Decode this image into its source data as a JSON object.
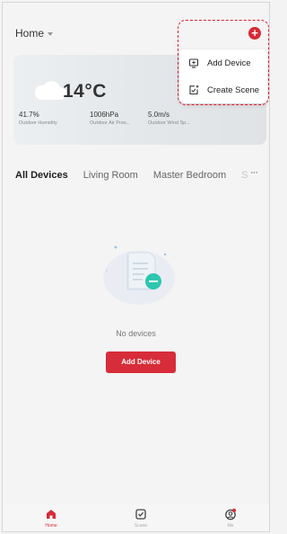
{
  "header": {
    "home_label": "Home",
    "add_symbol": "+"
  },
  "weather": {
    "temperature": "14°C",
    "humidity_value": "41.7%",
    "humidity_label": "Outdoor Humidity",
    "pressure_value": "1006hPa",
    "pressure_label": "Outdoor Air Pres...",
    "wind_value": "5.0m/s",
    "wind_label": "Outdoor Wind Sp..."
  },
  "tabs": [
    {
      "label": "All Devices",
      "active": true
    },
    {
      "label": "Living Room",
      "active": false
    },
    {
      "label": "Master Bedroom",
      "active": false
    },
    {
      "label": "S",
      "active": false
    }
  ],
  "tabs_more": "···",
  "empty_state": {
    "message": "No devices",
    "cta_label": "Add Device"
  },
  "dropdown": {
    "items": [
      {
        "label": "Add Device",
        "icon": "add-device-icon"
      },
      {
        "label": "Create Scene",
        "icon": "create-scene-icon"
      }
    ]
  },
  "bottom_nav": {
    "items": [
      {
        "label": "Home",
        "icon": "home-icon",
        "active": true
      },
      {
        "label": "Scene",
        "icon": "scene-icon",
        "active": false
      },
      {
        "label": "Me",
        "icon": "me-icon",
        "active": false
      }
    ]
  },
  "colors": {
    "accent": "#d62b38",
    "annotation": "#e0202c",
    "background": "#f4f4f4"
  }
}
